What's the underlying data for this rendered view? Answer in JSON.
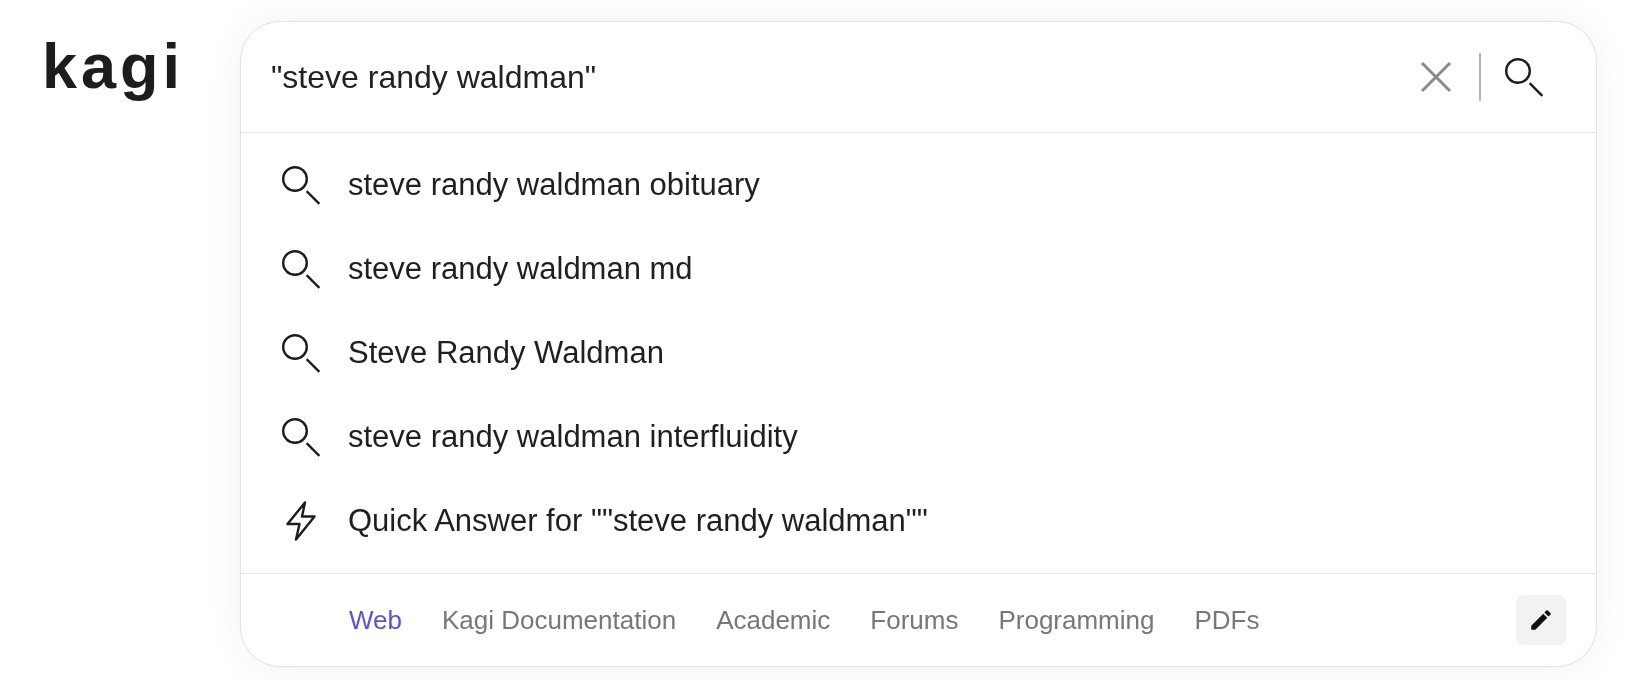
{
  "logo": {
    "text": "kagi"
  },
  "search": {
    "value": "\"steve randy waldman\""
  },
  "suggestions": [
    {
      "kind": "search",
      "text": "steve randy waldman obituary"
    },
    {
      "kind": "search",
      "text": "steve randy waldman md"
    },
    {
      "kind": "search",
      "text": "Steve Randy Waldman"
    },
    {
      "kind": "search",
      "text": "steve randy waldman interfluidity"
    },
    {
      "kind": "quick_answer",
      "text": "Quick Answer for \"\"steve randy waldman\"\""
    }
  ],
  "lenses": [
    {
      "label": "Web",
      "selected": true
    },
    {
      "label": "Kagi Documentation",
      "selected": false
    },
    {
      "label": "Academic",
      "selected": false
    },
    {
      "label": "Forums",
      "selected": false
    },
    {
      "label": "Programming",
      "selected": false
    },
    {
      "label": "PDFs",
      "selected": false
    }
  ]
}
